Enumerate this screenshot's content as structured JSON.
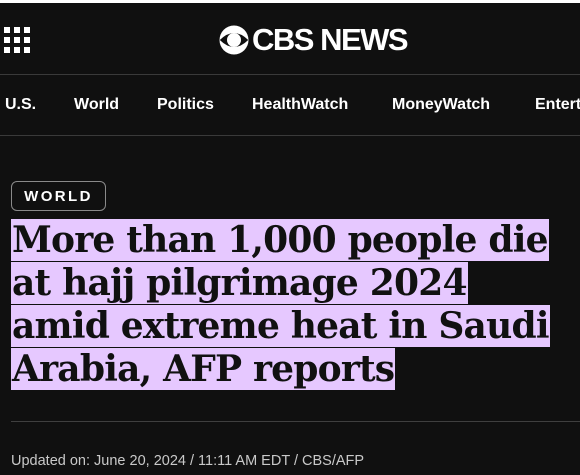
{
  "header": {
    "logo_text": "CBS NEWS",
    "menu_icon": "grid-menu-icon",
    "logo_icon": "cbs-eye-icon"
  },
  "nav": {
    "items": [
      "U.S.",
      "World",
      "Politics",
      "HealthWatch",
      "MoneyWatch",
      "Entert"
    ]
  },
  "article": {
    "section_badge": "WORLD",
    "headline": "More than 1,000 people die at hajj pilgrimage 2024 amid extreme heat in Saudi Arabia, AFP reports",
    "updated": "Updated on: June 20, 2024 / 11:11 AM EDT / CBS/AFP"
  },
  "colors": {
    "background": "#101010",
    "highlight": "#e6c8ff",
    "text": "#ffffff"
  }
}
